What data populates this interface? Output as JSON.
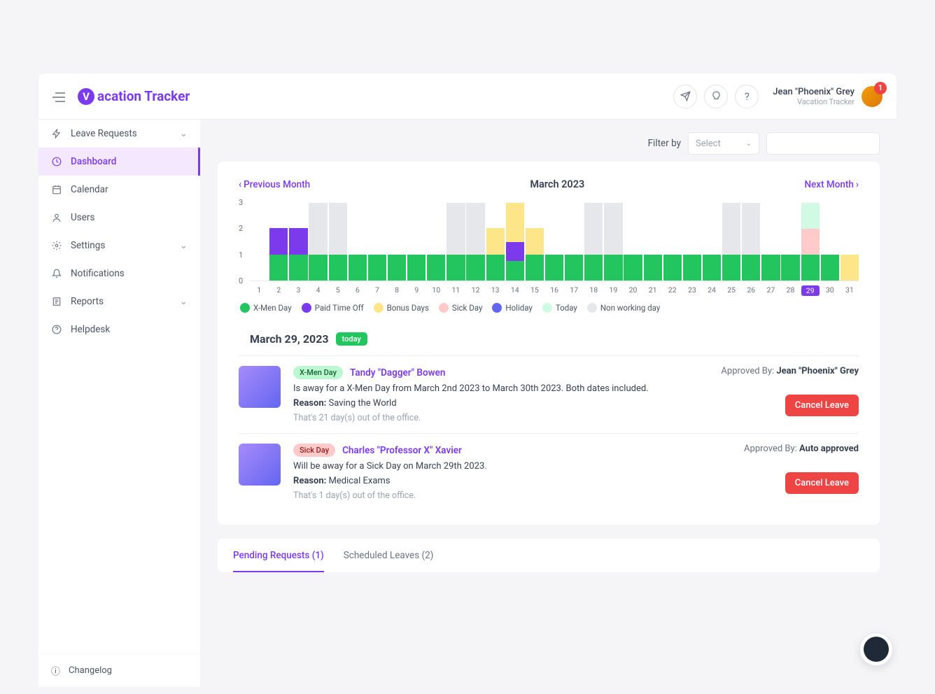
{
  "app": {
    "name": "Vacation Tracker",
    "logo_letter": "V",
    "logo_rest": "acation Tracker"
  },
  "user": {
    "name": "Jean \"Phoenix\" Grey",
    "org": "Vacation Tracker",
    "badge": "1"
  },
  "sidebar": {
    "items": [
      {
        "label": "Leave Requests",
        "chev": true
      },
      {
        "label": "Dashboard",
        "active": true
      },
      {
        "label": "Calendar"
      },
      {
        "label": "Users"
      },
      {
        "label": "Settings",
        "chev": true
      },
      {
        "label": "Notifications"
      },
      {
        "label": "Reports",
        "chev": true
      },
      {
        "label": "Helpdesk"
      }
    ],
    "footer": "Changelog"
  },
  "filter": {
    "label": "Filter by",
    "select_placeholder": "Select"
  },
  "calendar": {
    "prev": "Previous Month",
    "next": "Next Month",
    "title": "March 2023",
    "y_ticks": [
      "3",
      "2",
      "1",
      "0"
    ],
    "today_index": 29
  },
  "legend": [
    {
      "label": "X-Men Day",
      "color": "#22c55e"
    },
    {
      "label": "Paid Time Off",
      "color": "#7c3aed"
    },
    {
      "label": "Bonus Days",
      "color": "#fde68a"
    },
    {
      "label": "Sick Day",
      "color": "#fecaca"
    },
    {
      "label": "Holiday",
      "color": "#6366f1"
    },
    {
      "label": "Today",
      "color": "#d1fae5"
    },
    {
      "label": "Non working day",
      "color": "#e5e7eb"
    }
  ],
  "section": {
    "date": "March 29, 2023",
    "today_label": "today"
  },
  "leaves": [
    {
      "tag": "X-Men Day",
      "tag_bg": "#bbf7d0",
      "tag_color": "#166534",
      "person": "Tandy \"Dagger\" Bowen",
      "desc": "Is away for a X-Men Day from March 2nd 2023 to March 30th 2023. Both dates included.",
      "reason_label": "Reason:",
      "reason": "Saving the World",
      "meta": "That's 21 day(s) out of the office.",
      "approved_label": "Approved By:",
      "approved": "Jean \"Phoenix\" Grey",
      "cancel": "Cancel Leave"
    },
    {
      "tag": "Sick Day",
      "tag_bg": "#fecaca",
      "tag_color": "#991b1b",
      "person": "Charles \"Professor X\" Xavier",
      "desc": "Will be away for a Sick Day on March 29th 2023.",
      "reason_label": "Reason:",
      "reason": "Medical Exams",
      "meta": "That's 1 day(s) out of the office.",
      "approved_label": "Approved By:",
      "approved": "Auto approved",
      "cancel": "Cancel Leave"
    }
  ],
  "tabs": [
    {
      "label": "Pending Requests (1)",
      "active": true
    },
    {
      "label": "Scheduled Leaves (2)"
    }
  ],
  "chart_data": {
    "type": "bar",
    "title": "March 2023",
    "xlabel": "",
    "ylabel": "",
    "ylim": [
      0,
      3
    ],
    "categories": [
      1,
      2,
      3,
      4,
      5,
      6,
      7,
      8,
      9,
      10,
      11,
      12,
      13,
      14,
      15,
      16,
      17,
      18,
      19,
      20,
      21,
      22,
      23,
      24,
      25,
      26,
      27,
      28,
      29,
      30,
      31
    ],
    "series": [
      {
        "name": "X-Men Day",
        "color": "#22c55e",
        "values": [
          0,
          1,
          1,
          1,
          1,
          1,
          1,
          1,
          1,
          1,
          1,
          1,
          1,
          1,
          1,
          1,
          1,
          1,
          1,
          1,
          1,
          1,
          1,
          1,
          1,
          1,
          1,
          1,
          1,
          1,
          0
        ]
      },
      {
        "name": "Paid Time Off",
        "color": "#7c3aed",
        "values": [
          0,
          1,
          1,
          0,
          0,
          0,
          0,
          0,
          0,
          0,
          0,
          0,
          0,
          1,
          0,
          0,
          0,
          0,
          0,
          0,
          0,
          0,
          0,
          0,
          0,
          0,
          0,
          0,
          0,
          0,
          0
        ]
      },
      {
        "name": "Bonus Days",
        "color": "#fde68a",
        "values": [
          0,
          0,
          0,
          0,
          0,
          0,
          0,
          0,
          0,
          0,
          0,
          0,
          1,
          2,
          1,
          0,
          0,
          0,
          0,
          0,
          0,
          0,
          0,
          0,
          0,
          0,
          0,
          0,
          0,
          0,
          1
        ]
      },
      {
        "name": "Sick Day",
        "color": "#fecaca",
        "values": [
          0,
          0,
          0,
          0,
          0,
          0,
          0,
          0,
          0,
          0,
          0,
          0,
          0,
          0,
          0,
          0,
          0,
          0,
          0,
          0,
          0,
          0,
          0,
          0,
          0,
          0,
          0,
          0,
          1,
          0,
          0
        ]
      },
      {
        "name": "Today",
        "color": "#d1fae5",
        "values": [
          0,
          0,
          0,
          0,
          0,
          0,
          0,
          0,
          0,
          0,
          0,
          0,
          0,
          0,
          0,
          0,
          0,
          0,
          0,
          0,
          0,
          0,
          0,
          0,
          0,
          0,
          0,
          0,
          1,
          0,
          0
        ]
      },
      {
        "name": "Non working day",
        "color": "#e5e7eb",
        "values": [
          0,
          0,
          0,
          2,
          2,
          0,
          0,
          0,
          0,
          0,
          2,
          2,
          0,
          0,
          0,
          0,
          0,
          2,
          2,
          0,
          0,
          0,
          0,
          0,
          2,
          2,
          0,
          0,
          0,
          0,
          0
        ]
      }
    ]
  }
}
